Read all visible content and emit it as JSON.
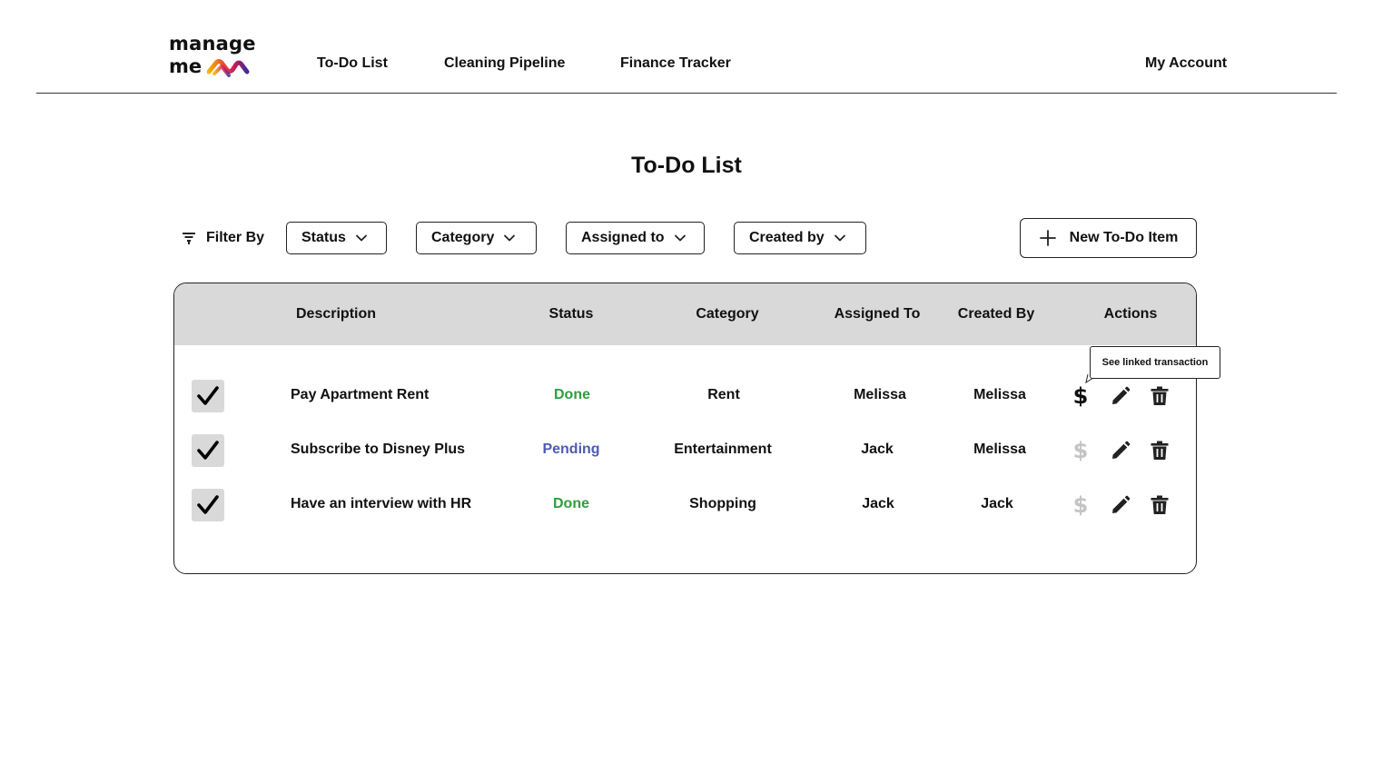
{
  "app": {
    "logo_line1": "manage",
    "logo_line2": "me"
  },
  "nav": {
    "items": [
      {
        "label": "To-Do List"
      },
      {
        "label": "Cleaning Pipeline"
      },
      {
        "label": "Finance Tracker"
      }
    ],
    "account_label": "My Account"
  },
  "page": {
    "title": "To-Do List"
  },
  "filters": {
    "label": "Filter By",
    "dropdowns": [
      {
        "label": "Status"
      },
      {
        "label": "Category"
      },
      {
        "label": "Assigned to"
      },
      {
        "label": "Created by"
      }
    ],
    "new_button_label": "New To-Do Item"
  },
  "table": {
    "columns": [
      "Description",
      "Status",
      "Category",
      "Assigned To",
      "Created By",
      "Actions"
    ],
    "rows": [
      {
        "checked": true,
        "description": "Pay Apartment Rent",
        "status": "Done",
        "category": "Rent",
        "assigned_to": "Melissa",
        "created_by": "Melissa",
        "has_linked_transaction": true
      },
      {
        "checked": true,
        "description": "Subscribe to Disney Plus",
        "status": "Pending",
        "category": "Entertainment",
        "assigned_to": "Jack",
        "created_by": "Melissa",
        "has_linked_transaction": false
      },
      {
        "checked": true,
        "description": "Have an interview with HR",
        "status": "Done",
        "category": "Shopping",
        "assigned_to": "Jack",
        "created_by": "Jack",
        "has_linked_transaction": false
      }
    ],
    "action_icons": {
      "transaction": "$",
      "edit": "pencil-icon",
      "delete": "trash-icon"
    }
  },
  "tooltip": {
    "text": "See linked transaction"
  },
  "colors": {
    "status_done": "#2e9e3e",
    "status_pending": "#4d5bb3",
    "header_bg": "#d9d9d9",
    "dollar_active": "#111111",
    "dollar_inactive": "#c4c4c4",
    "logo_gradient": [
      "#f5b400",
      "#e8453c",
      "#c2185b",
      "#3a2d9b"
    ]
  }
}
